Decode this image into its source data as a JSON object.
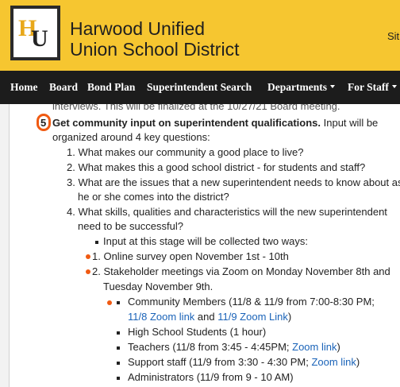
{
  "header": {
    "logo_letters": "HU",
    "district_line1": "Harwood Unified",
    "district_line2": "Union School District",
    "site_fragment": "Sit"
  },
  "nav": {
    "items": [
      {
        "label": "Home"
      },
      {
        "label": "Board"
      },
      {
        "label": "Bond Plan"
      },
      {
        "label": "Superintendent Search"
      },
      {
        "label": "Departments"
      },
      {
        "label": "For Staff"
      }
    ]
  },
  "content": {
    "top_cut": "interviews. This will be finalized at the 10/27/21 Board meeting.",
    "step5_number": "5",
    "step5_bold": "Get community input on superintendent qualifications.",
    "step5_rest": " Input will be",
    "step5_line2": "organized around 4 key questions:",
    "questions": [
      "1. What makes our community a good place to live?",
      "2. What makes this a good school district - for students and staff?",
      "3. What are the issues that a new superintendent needs to know about as",
      "he or she comes into the district?",
      "4. What skills, qualities and characteristics will the new superintendent",
      "need to be successful?"
    ],
    "collect_intro": "Input at this stage will be collected two ways:",
    "way1": "1. Online survey open November 1st - 10th",
    "way2_line1": "2. Stakeholder meetings via Zoom on Monday November 8th and",
    "way2_line2": "Tuesday November 9th.",
    "groups": {
      "community": "Community Members (11/8 & 11/9 from 7:00-8:30 PM;",
      "community_link1": "11/8 Zoom link",
      "community_and": " and ",
      "community_link2": "11/9 Zoom Link",
      "community_close": ")",
      "hs_students": "High School Students (1 hour)",
      "teachers": "Teachers (11/8 from 3:45 - 4:45PM; ",
      "teachers_link": "Zoom link",
      "teachers_close": ")",
      "support": "Support staff (11/9 from 3:30 - 4:30 PM; ",
      "support_link": "Zoom link",
      "support_close": ")",
      "admins": "Administrators (11/9 from 9 - 10 AM)"
    }
  },
  "colors": {
    "header_bg": "#f6c630",
    "nav_bg": "#1c1c1c",
    "link": "#1a63b8",
    "annotation": "#f05a12"
  }
}
